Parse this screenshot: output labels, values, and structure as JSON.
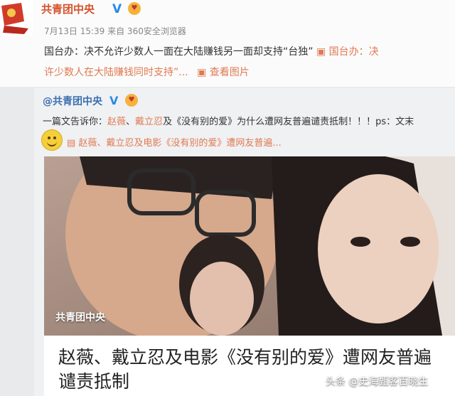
{
  "post": {
    "author": "共青团中央",
    "verified_mark": "V",
    "meta": "7月13日 15:39 来自 360安全浏览器",
    "text_line1_prefix": "国台办：决不允许少数人一面在大陆赚钱另一面却支持“台独”",
    "text_line1_link": "国台办：决",
    "text_line2_link": "许少数人在大陆赚钱同时支持”...",
    "view_images": "查看图片"
  },
  "repost": {
    "author": "@共青团中央",
    "verified_mark": "V",
    "text_prefix": "一篇文告诉你：",
    "text_name1": "赵薇",
    "text_sep": "、",
    "text_name2": "戴立忍",
    "text_rest": "及《没有别的爱》为什么遭网友普遍谴责抵制！！！ps：文末",
    "link_text": "赵薇、戴立忍及电影《没有别的爱》遭网友普遍...",
    "photo_watermark": "共青团中央",
    "card_title": "赵薇、戴立忍及电影《没有别的爱》遭网友普遍谴责抵制"
  },
  "footer_watermark": "头条 @史海甄客百晓生",
  "icons": [
    "party-flag-icon",
    "verified-icon",
    "fan-badge-icon",
    "smiley-icon",
    "image-icon",
    "link-icon"
  ],
  "colors": {
    "accent": "#e07a52",
    "name": "#d6502a",
    "link_blue": "#3a6fb0"
  }
}
